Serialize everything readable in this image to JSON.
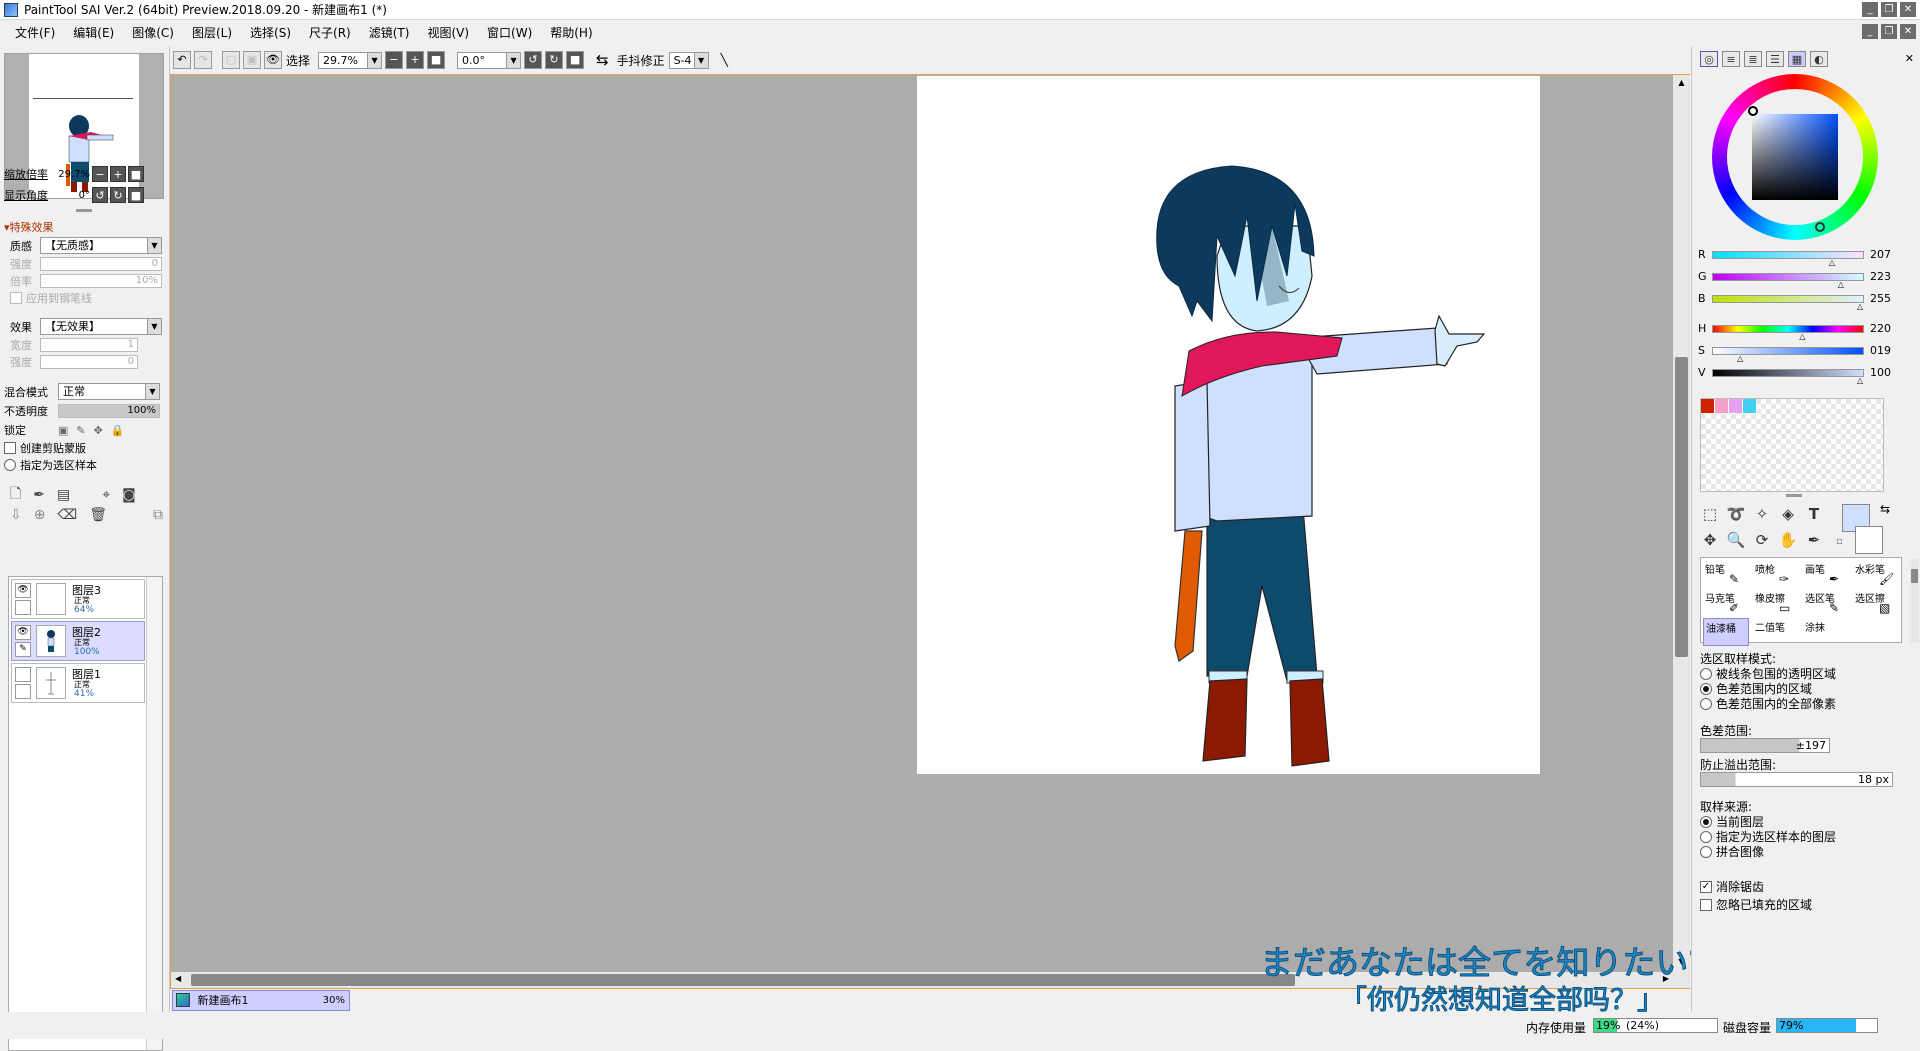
{
  "window": {
    "title": "PaintTool SAI Ver.2 (64bit) Preview.2018.09.20 - 新建画布1 (*)"
  },
  "menu": [
    "文件(F)",
    "编辑(E)",
    "图像(C)",
    "图层(L)",
    "选择(S)",
    "尺子(R)",
    "滤镜(T)",
    "视图(V)",
    "窗口(W)",
    "帮助(H)"
  ],
  "toolbar": {
    "select_label": "选择",
    "zoom": "29.7%",
    "rotation": "0.0°",
    "stabilizer_label": "手抖修正",
    "stabilizer_value": "S-4"
  },
  "navigator": {
    "zoom_label": "缩放倍率",
    "zoom_value": "29.7%",
    "angle_label": "显示角度",
    "angle_value": "0°"
  },
  "effects": {
    "header": "特殊效果",
    "texture_label": "质感",
    "texture_value": "【无质感】",
    "strength_label": "强度",
    "strength_value": "0",
    "scale_label": "倍率",
    "scale_value": "10%",
    "apply_label": "应用到钢笔线",
    "effect_label": "效果",
    "effect_value": "【无效果】",
    "width_label": "宽度",
    "width_value": "1",
    "effect_strength_label": "强度",
    "effect_strength_value": "0"
  },
  "layer_props": {
    "blend_label": "混合模式",
    "blend_value": "正常",
    "opacity_label": "不透明度",
    "opacity_value": "100%",
    "lock_label": "锁定",
    "clip_label": "创建剪贴蒙版",
    "sample_label": "指定为选区样本"
  },
  "layers": [
    {
      "name": "图层3",
      "mode": "正常",
      "opacity": "64%"
    },
    {
      "name": "图层2",
      "mode": "正常",
      "opacity": "100%"
    },
    {
      "name": "图层1",
      "mode": "正常",
      "opacity": "41%"
    }
  ],
  "canvas_tab": {
    "name": "新建画布1",
    "zoom": "30%"
  },
  "color": {
    "current": "#cfdfff",
    "R": "207",
    "G": "223",
    "B": "255",
    "H": "220",
    "S": "019",
    "V": "100",
    "swatches": [
      "#cc2200",
      "#f5a0c8",
      "#e8a0f0",
      "#40d0f0"
    ],
    "rgb_fraction": {
      "R": 0.81,
      "G": 0.87,
      "B": 1.0
    },
    "hsv_fraction": {
      "H": 0.61,
      "S": 0.19,
      "V": 1.0
    }
  },
  "brushes": [
    "铅笔",
    "喷枪",
    "画笔",
    "水彩笔",
    "马克笔",
    "橡皮擦",
    "选区笔",
    "选区擦",
    "油漆桶",
    "二值笔",
    "涂抹"
  ],
  "tool_options": {
    "mode_label": "选区取样模式:",
    "mode_opts": [
      "被线条包围的透明区域",
      "色差范围内的区域",
      "色差范围内的全部像素"
    ],
    "mode_selected": 1,
    "range_label": "色差范围:",
    "range_value": "±197",
    "overflow_label": "防止溢出范围:",
    "overflow_value": "18 px",
    "source_label": "取样来源:",
    "source_opts": [
      "当前图层",
      "指定为选区样本的图层",
      "拼合图像"
    ],
    "source_selected": 0,
    "antialias_label": "消除锯齿",
    "ignore_label": "忽略已填充的区域"
  },
  "status": {
    "mem_label": "内存使用量",
    "mem_value": "19%",
    "mem_extra": "(24%)",
    "mem_fraction": 0.19,
    "disk_label": "磁盘容量",
    "disk_value": "79%",
    "disk_fraction": 0.79
  },
  "subtitles": {
    "line1": "まだあなたは全てを知りたい?",
    "line2": "「你仍然想知道全部吗？」"
  }
}
